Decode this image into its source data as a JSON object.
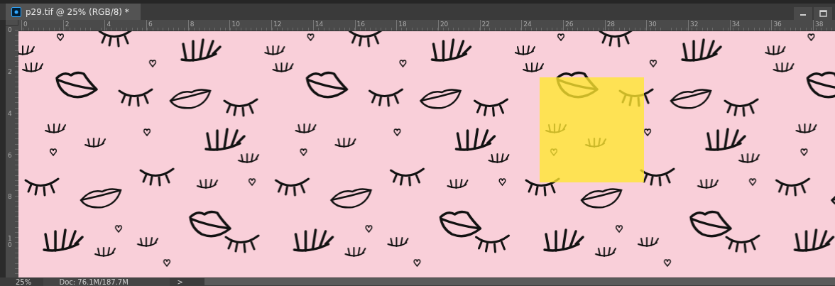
{
  "document_tab": {
    "title": "p29.tif @ 25% (RGB/8) *"
  },
  "horizontal_ruler": {
    "labels": [
      "0",
      "2",
      "4",
      "6",
      "8",
      "10",
      "12",
      "14",
      "16",
      "18",
      "20",
      "22",
      "24",
      "26",
      "28",
      "30",
      "32",
      "34",
      "36",
      "38"
    ]
  },
  "vertical_ruler": {
    "labels": [
      "0",
      "2",
      "4",
      "6",
      "8",
      "10"
    ]
  },
  "status_bar": {
    "zoom": "25%",
    "doc_size": "Doc: 76.1M/187.7M",
    "arrow": ">"
  }
}
